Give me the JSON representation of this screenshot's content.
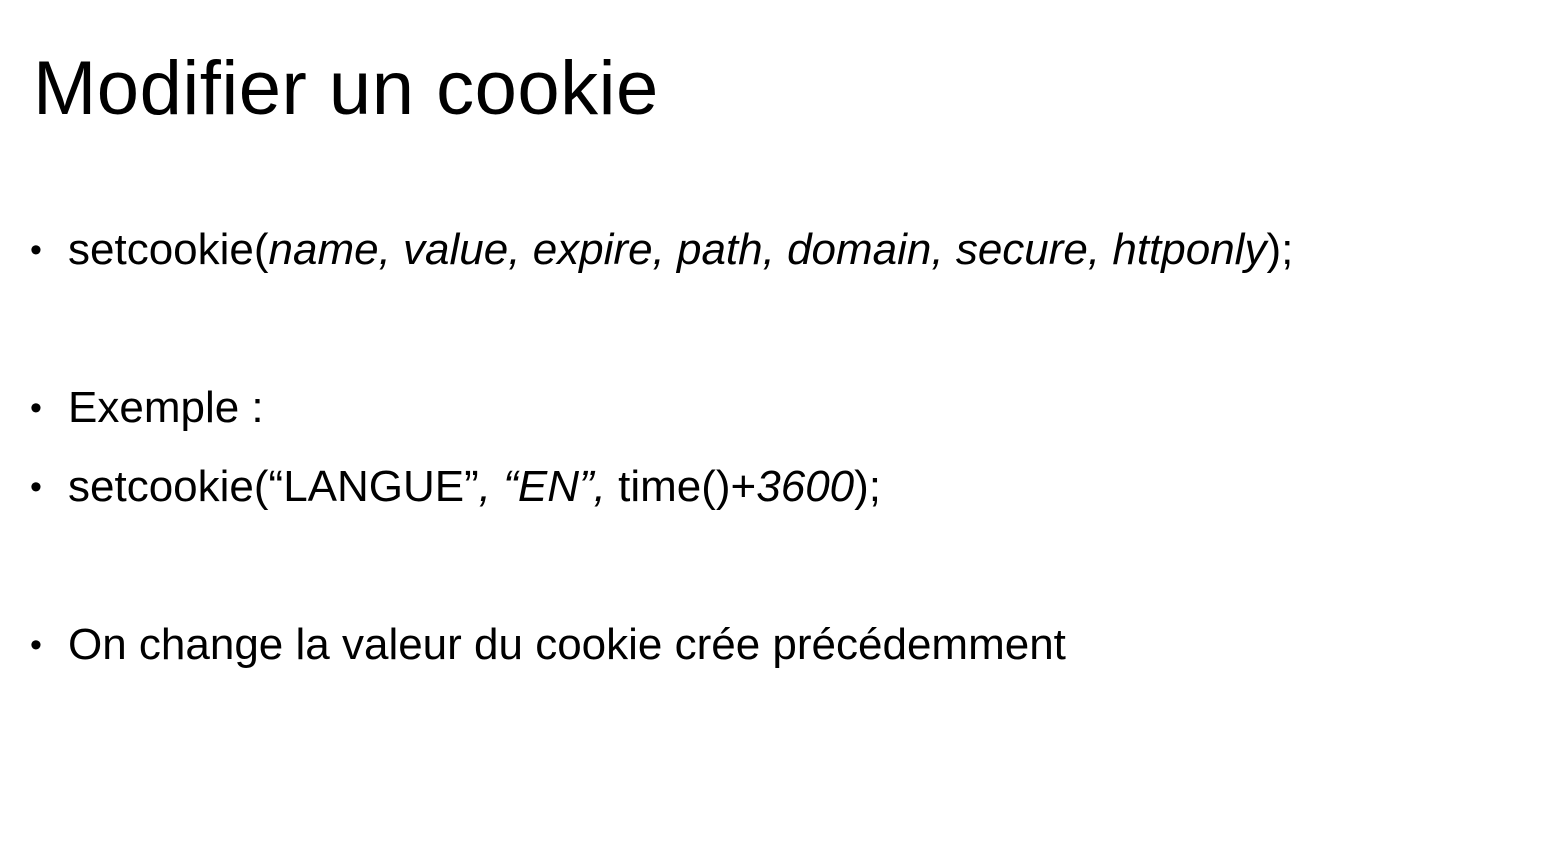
{
  "slide": {
    "title": "Modifier un cookie",
    "bullet_glyph": "•",
    "lines": [
      {
        "parts": [
          {
            "text": "setcookie(",
            "italic": false
          },
          {
            "text": "name, value, expire, path, domain, secure, httponly",
            "italic": true
          },
          {
            "text": ");",
            "italic": false
          }
        ]
      },
      {
        "parts": [
          {
            "text": "Exemple :",
            "italic": false
          }
        ]
      },
      {
        "parts": [
          {
            "text": "setcookie(“LANGUE”",
            "italic": false
          },
          {
            "text": ", “EN”,",
            "italic": true
          },
          {
            "text": " time()+",
            "italic": false
          },
          {
            "text": "3600",
            "italic": true
          },
          {
            "text": ");",
            "italic": false
          }
        ]
      },
      {
        "parts": [
          {
            "text": "On change la valeur du cookie crée précédemment",
            "italic": false
          }
        ]
      }
    ]
  }
}
